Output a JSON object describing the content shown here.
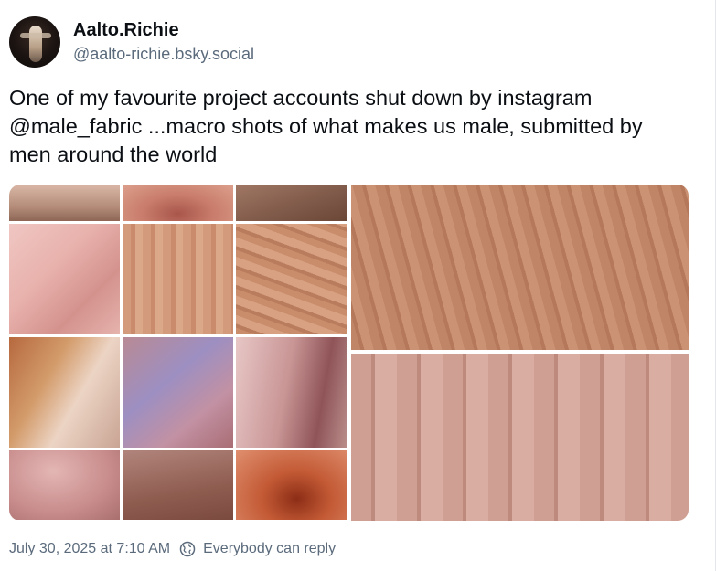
{
  "author": {
    "display_name": "Aalto.Richie",
    "handle": "@aalto-richie.bsky.social",
    "avatar_icon": "profile-photo"
  },
  "post": {
    "text": "One of my favourite project accounts shut down by instagram @male_fabric ...macro shots of what makes us male, submitted by men around the world"
  },
  "media": {
    "images": [
      {
        "name": "collage-grid"
      },
      {
        "name": "macro-skin-top"
      },
      {
        "name": "macro-skin-bottom"
      }
    ]
  },
  "footer": {
    "timestamp": "July 30, 2025 at 7:10 AM",
    "reply_setting": "Everybody can reply",
    "reply_icon": "globe-icon"
  }
}
